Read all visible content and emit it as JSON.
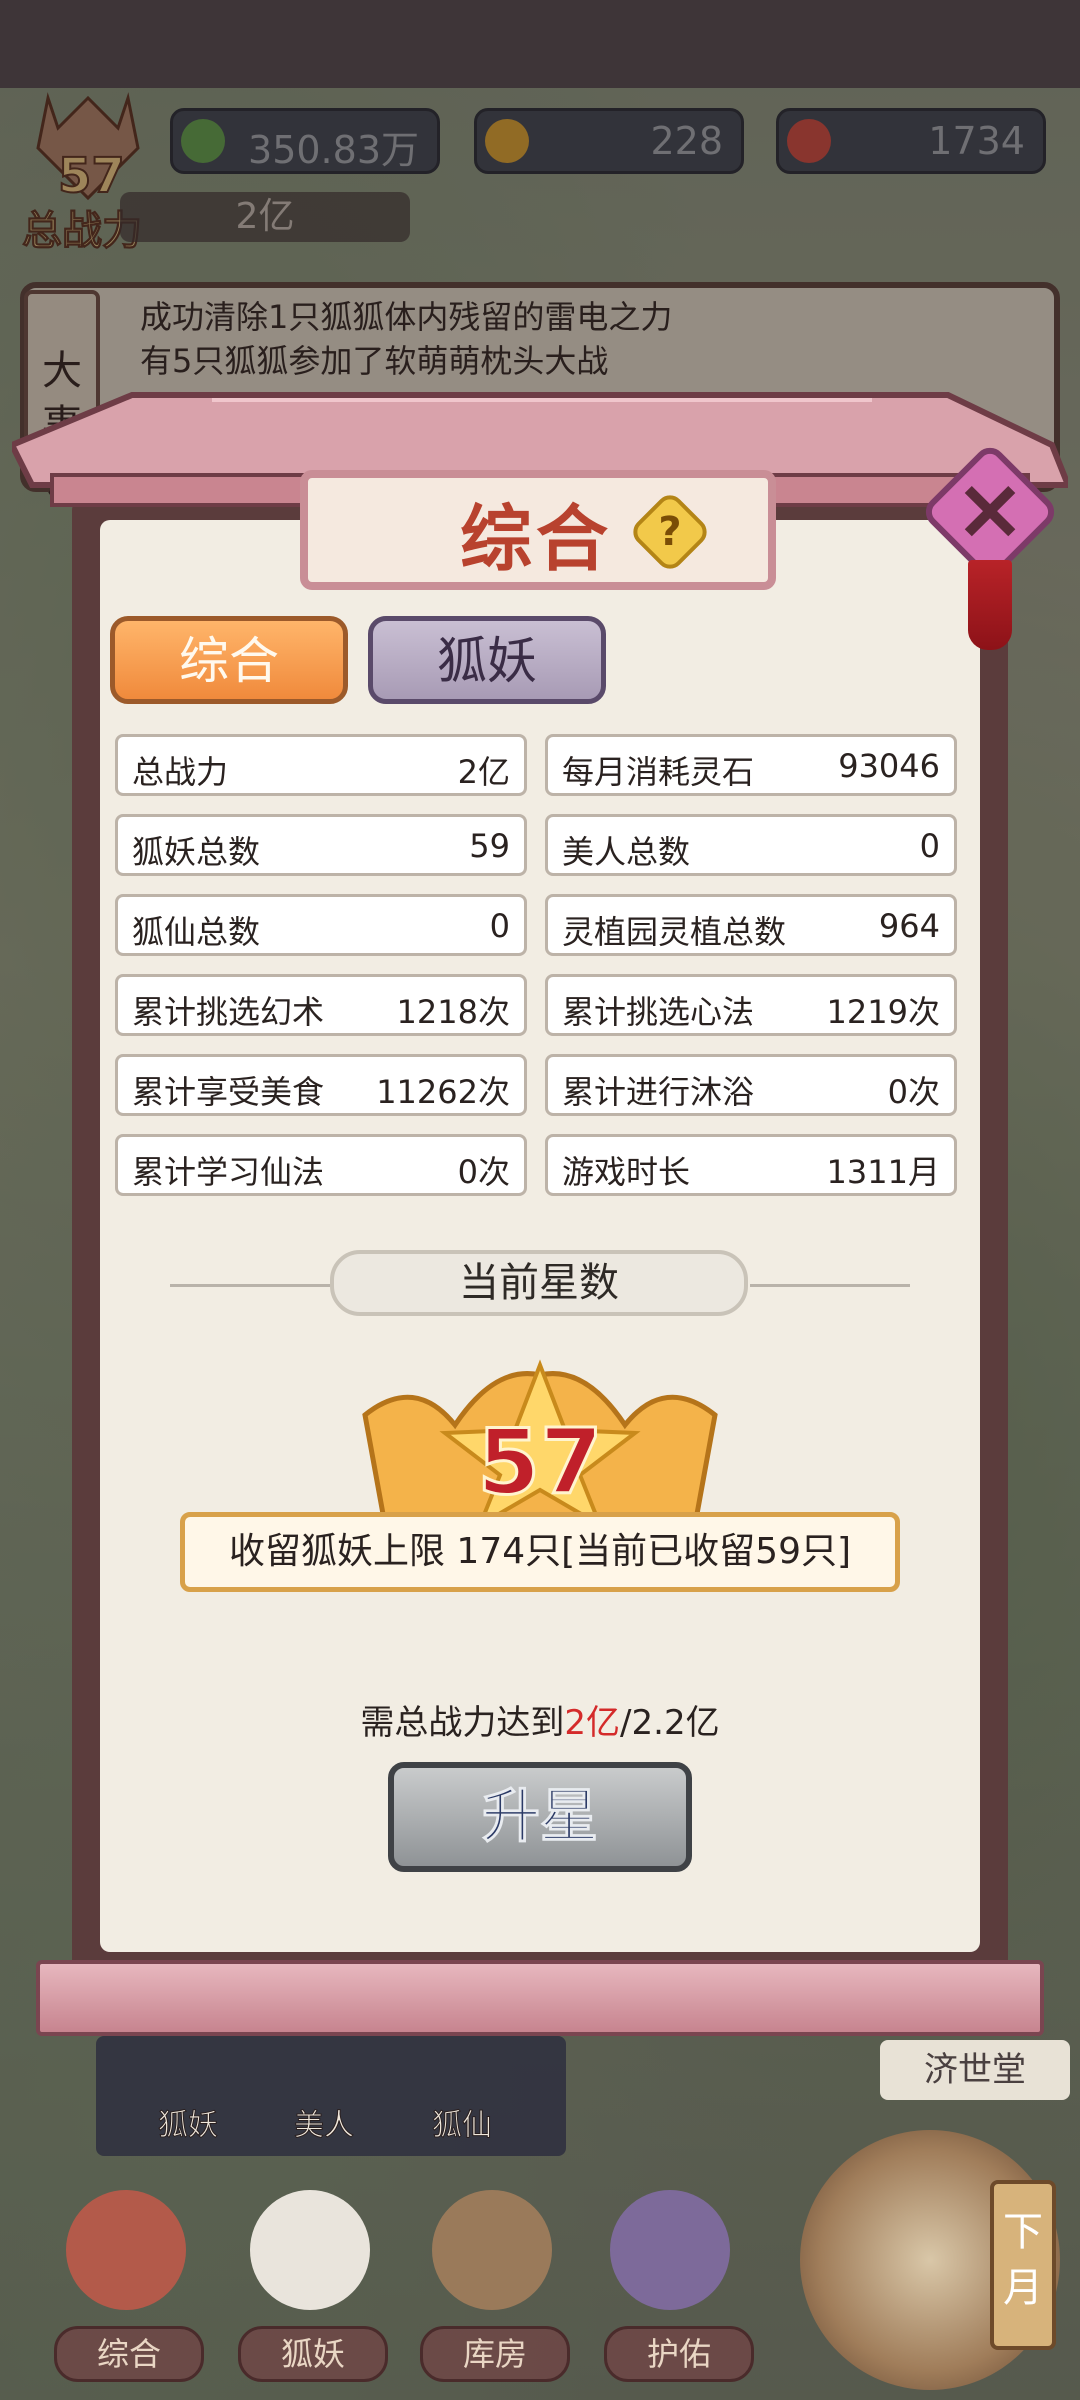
{
  "resources": [
    {
      "name": "spirit-stone",
      "value": "350.83万",
      "color": "#5fa84a"
    },
    {
      "name": "gold",
      "value": "228",
      "color": "#e7a92b"
    },
    {
      "name": "fruit",
      "value": "1734",
      "color": "#d9473b"
    }
  ],
  "player": {
    "level": "57",
    "power_label": "总战力",
    "power_value": "2亿"
  },
  "events": {
    "tab_label": "大事记",
    "lines": [
      "成功清除1只狐狐体内残留的雷电之力",
      "有5只狐狐参加了软萌萌枕头大战",
      "…………"
    ]
  },
  "dialog": {
    "title": "综合",
    "help": "?",
    "close": "×",
    "tabs": [
      {
        "label": "综合",
        "active": true
      },
      {
        "label": "狐妖",
        "active": false
      }
    ],
    "stats_left": [
      {
        "label": "总战力",
        "value": "2亿"
      },
      {
        "label": "狐妖总数",
        "value": "59"
      },
      {
        "label": "狐仙总数",
        "value": "0"
      },
      {
        "label": "累计挑选幻术",
        "value": "1218次"
      },
      {
        "label": "累计享受美食",
        "value": "11262次"
      },
      {
        "label": "累计学习仙法",
        "value": "0次"
      }
    ],
    "stats_right": [
      {
        "label": "每月消耗灵石",
        "value": "93046"
      },
      {
        "label": "美人总数",
        "value": "0"
      },
      {
        "label": "灵植园灵植总数",
        "value": "964"
      },
      {
        "label": "累计挑选心法",
        "value": "1219次"
      },
      {
        "label": "累计进行沐浴",
        "value": "0次"
      },
      {
        "label": "游戏时长",
        "value": "1311月"
      }
    ],
    "star_section_label": "当前星数",
    "star_count": "57",
    "capacity_text": "收留狐妖上限 174只[当前已收留59只]",
    "requirement_prefix": "需总战力达到",
    "requirement_current": "2亿",
    "requirement_target": "/2.2亿",
    "upgrade_label": "升星"
  },
  "hud": {
    "building_label": "济世堂",
    "subnav": [
      "狐妖",
      "美人",
      "狐仙"
    ],
    "nav": [
      "综合",
      "狐妖",
      "库房",
      "护佑"
    ],
    "next_month": "下月"
  },
  "colors": {
    "accent": "#f08a3c",
    "title": "#b8422e",
    "highlight": "#d42a2a"
  }
}
